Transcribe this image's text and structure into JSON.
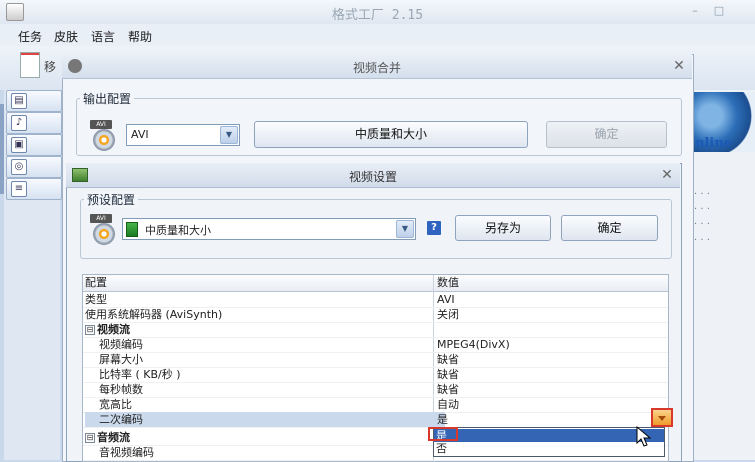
{
  "app": {
    "title": "格式工厂 2.15",
    "window_controls": [
      "–",
      "□"
    ]
  },
  "menu": [
    "任务",
    "皮肤",
    "语言",
    "帮助"
  ],
  "toolbar": {
    "partial_label": "移"
  },
  "sidebar_icons": [
    "video-icon",
    "audio-icon",
    "image-icon",
    "disc-icon",
    "doc-icon"
  ],
  "right_panel": {
    "brand_fragment": "nline",
    "dots": [
      ". . .",
      ". . .",
      ". . .",
      ". . ."
    ]
  },
  "merge_dialog": {
    "title": "视频合并",
    "output_group_label": "输出配置",
    "format_select": {
      "value": "AVI"
    },
    "quality_button": "中质量和大小",
    "ok_button": "确定"
  },
  "video_settings": {
    "title": "视频设置",
    "preset_group_label": "预设配置",
    "preset_select": {
      "value": "中质量和大小"
    },
    "help": "?",
    "save_as_button": "另存为",
    "ok_button": "确定",
    "grid_header": {
      "name": "配置",
      "value": "数值"
    },
    "rows": [
      {
        "name": "类型",
        "value": "AVI",
        "kind": "prop"
      },
      {
        "name": "使用系统解码器 (AviSynth)",
        "value": "关闭",
        "kind": "prop"
      },
      {
        "name": "视频流",
        "value": "",
        "kind": "section",
        "toggle": "⊟"
      },
      {
        "name": "视频编码",
        "value": "MPEG4(DivX)",
        "kind": "child"
      },
      {
        "name": "屏幕大小",
        "value": "缺省",
        "kind": "child"
      },
      {
        "name": "比特率 ( KB/秒 )",
        "value": "缺省",
        "kind": "child"
      },
      {
        "name": "每秒帧数",
        "value": "缺省",
        "kind": "child"
      },
      {
        "name": "宽高比",
        "value": "自动",
        "kind": "child"
      },
      {
        "name": "二次编码",
        "value": "是",
        "kind": "child",
        "selected": true
      },
      {
        "name": "音频流",
        "value": "",
        "kind": "section",
        "toggle": "⊟"
      },
      {
        "name": "音视频编码",
        "value": "",
        "kind": "child"
      }
    ],
    "dropdown": {
      "options": [
        "是",
        "否"
      ],
      "highlighted_index": 0
    },
    "format_tag": "AVI"
  },
  "colors": {
    "highlight": "#3464b4",
    "annotation_red": "#d9382c"
  }
}
